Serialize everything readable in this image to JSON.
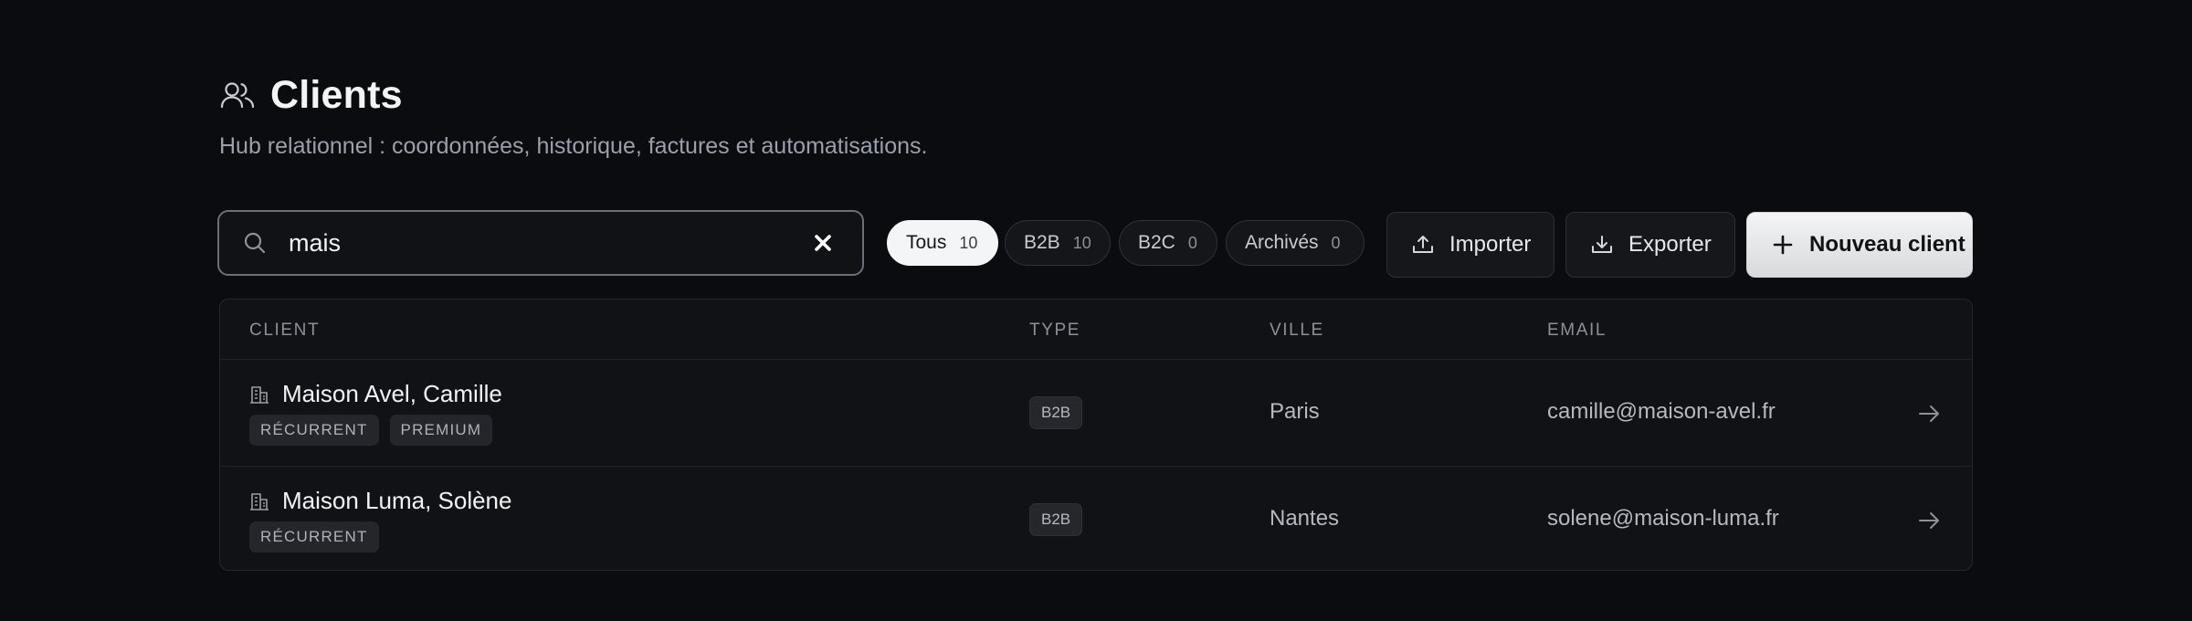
{
  "header": {
    "title": "Clients",
    "subtitle": "Hub relationnel : coordonnées, historique, factures et automatisations.",
    "icon": "users-icon"
  },
  "search": {
    "value": "mais",
    "placeholder": "",
    "clear_icon": "close-icon"
  },
  "filters": [
    {
      "label": "Tous",
      "count": "10",
      "active": true
    },
    {
      "label": "B2B",
      "count": "10",
      "active": false
    },
    {
      "label": "B2C",
      "count": "0",
      "active": false
    },
    {
      "label": "Archivés",
      "count": "0",
      "active": false
    }
  ],
  "actions": {
    "import_label": "Importer",
    "export_label": "Exporter",
    "new_label": "Nouveau client"
  },
  "table": {
    "columns": [
      "CLIENT",
      "TYPE",
      "VILLE",
      "EMAIL"
    ],
    "rows": [
      {
        "name": "Maison Avel, Camille",
        "tags": [
          "RÉCURRENT",
          "PREMIUM"
        ],
        "type": "B2B",
        "city": "Paris",
        "email": "camille@maison-avel.fr"
      },
      {
        "name": "Maison Luma, Solène",
        "tags": [
          "RÉCURRENT"
        ],
        "type": "B2B",
        "city": "Nantes",
        "email": "solene@maison-luma.fr"
      }
    ]
  },
  "colors": {
    "background": "#0b0c0f",
    "surface": "#111215",
    "primary_button": "#f4f4f6",
    "active_chip": "#f4f5f7",
    "muted_text": "#9aa0aa"
  }
}
